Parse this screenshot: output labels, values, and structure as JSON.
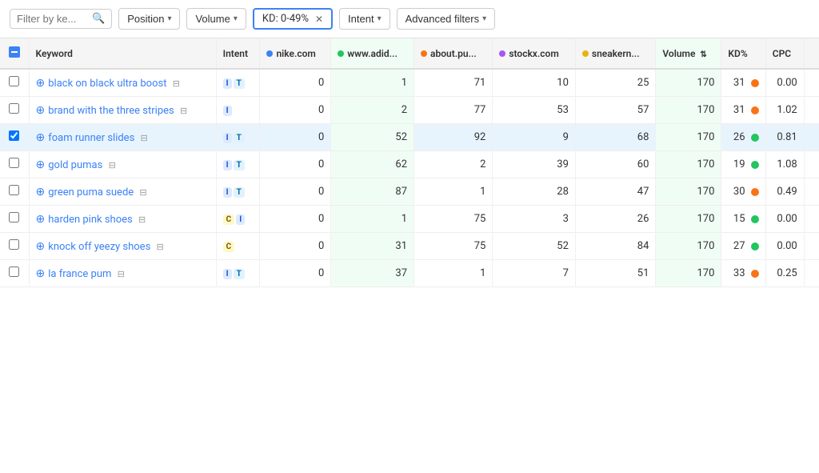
{
  "toolbar": {
    "filter_placeholder": "Filter by ke...",
    "search_icon": "🔍",
    "position_label": "Position",
    "volume_label": "Volume",
    "kd_filter_label": "KD: 0-49%",
    "intent_label": "Intent",
    "advanced_filters_label": "Advanced filters"
  },
  "table": {
    "columns": [
      {
        "key": "checkbox",
        "label": ""
      },
      {
        "key": "keyword",
        "label": "Keyword"
      },
      {
        "key": "intent",
        "label": "Intent"
      },
      {
        "key": "nike",
        "label": "nike.com",
        "dot": "blue"
      },
      {
        "key": "adidas",
        "label": "www.adid...",
        "dot": "green"
      },
      {
        "key": "about",
        "label": "about.pu...",
        "dot": "orange"
      },
      {
        "key": "stockx",
        "label": "stockx.com",
        "dot": "purple"
      },
      {
        "key": "sneakern",
        "label": "sneakern...",
        "dot": "yellow"
      },
      {
        "key": "volume",
        "label": "Volume"
      },
      {
        "key": "kd",
        "label": "KD%"
      },
      {
        "key": "cpc",
        "label": "CPC"
      },
      {
        "key": "extra",
        "label": ""
      }
    ],
    "rows": [
      {
        "id": 1,
        "selected": false,
        "keyword": "black on black ultra boost",
        "intent": [
          {
            "label": "I",
            "type": "i"
          },
          {
            "label": "T",
            "type": "t"
          }
        ],
        "nike": "0",
        "adidas": "1",
        "about": "71",
        "stockx": "10",
        "sneakern": "25",
        "volume": "170",
        "kd": "31",
        "kd_color": "orange",
        "cpc": "0.00",
        "extra": ""
      },
      {
        "id": 2,
        "selected": false,
        "keyword": "brand with the three stripes",
        "intent": [
          {
            "label": "I",
            "type": "i"
          }
        ],
        "nike": "0",
        "adidas": "2",
        "about": "77",
        "stockx": "53",
        "sneakern": "57",
        "volume": "170",
        "kd": "31",
        "kd_color": "orange",
        "cpc": "1.02",
        "extra": ""
      },
      {
        "id": 3,
        "selected": true,
        "keyword": "foam runner slides",
        "intent": [
          {
            "label": "I",
            "type": "i"
          },
          {
            "label": "T",
            "type": "t"
          }
        ],
        "nike": "0",
        "adidas": "52",
        "about": "92",
        "stockx": "9",
        "sneakern": "68",
        "volume": "170",
        "kd": "26",
        "kd_color": "green",
        "cpc": "0.81",
        "extra": ""
      },
      {
        "id": 4,
        "selected": false,
        "keyword": "gold pumas",
        "intent": [
          {
            "label": "I",
            "type": "i"
          },
          {
            "label": "T",
            "type": "t"
          }
        ],
        "nike": "0",
        "adidas": "62",
        "about": "2",
        "stockx": "39",
        "sneakern": "60",
        "volume": "170",
        "kd": "19",
        "kd_color": "green",
        "cpc": "1.08",
        "extra": ""
      },
      {
        "id": 5,
        "selected": false,
        "keyword": "green puma suede",
        "intent": [
          {
            "label": "I",
            "type": "i"
          },
          {
            "label": "T",
            "type": "t"
          }
        ],
        "nike": "0",
        "adidas": "87",
        "about": "1",
        "stockx": "28",
        "sneakern": "47",
        "volume": "170",
        "kd": "30",
        "kd_color": "orange",
        "cpc": "0.49",
        "extra": ""
      },
      {
        "id": 6,
        "selected": false,
        "keyword": "harden pink shoes",
        "intent": [
          {
            "label": "C",
            "type": "c"
          },
          {
            "label": "I",
            "type": "i"
          }
        ],
        "nike": "0",
        "adidas": "1",
        "about": "75",
        "stockx": "3",
        "sneakern": "26",
        "volume": "170",
        "kd": "15",
        "kd_color": "green",
        "cpc": "0.00",
        "extra": ""
      },
      {
        "id": 7,
        "selected": false,
        "keyword": "knock off yeezy shoes",
        "intent": [
          {
            "label": "C",
            "type": "c"
          }
        ],
        "nike": "0",
        "adidas": "31",
        "about": "75",
        "stockx": "52",
        "sneakern": "84",
        "volume": "170",
        "kd": "27",
        "kd_color": "green",
        "cpc": "0.00",
        "extra": ""
      },
      {
        "id": 8,
        "selected": false,
        "keyword": "la france pum",
        "intent": [
          {
            "label": "I",
            "type": "i"
          },
          {
            "label": "T",
            "type": "t"
          }
        ],
        "nike": "0",
        "adidas": "37",
        "about": "1",
        "stockx": "7",
        "sneakern": "51",
        "volume": "170",
        "kd": "33",
        "kd_color": "orange",
        "cpc": "0.25",
        "extra": ""
      }
    ]
  }
}
